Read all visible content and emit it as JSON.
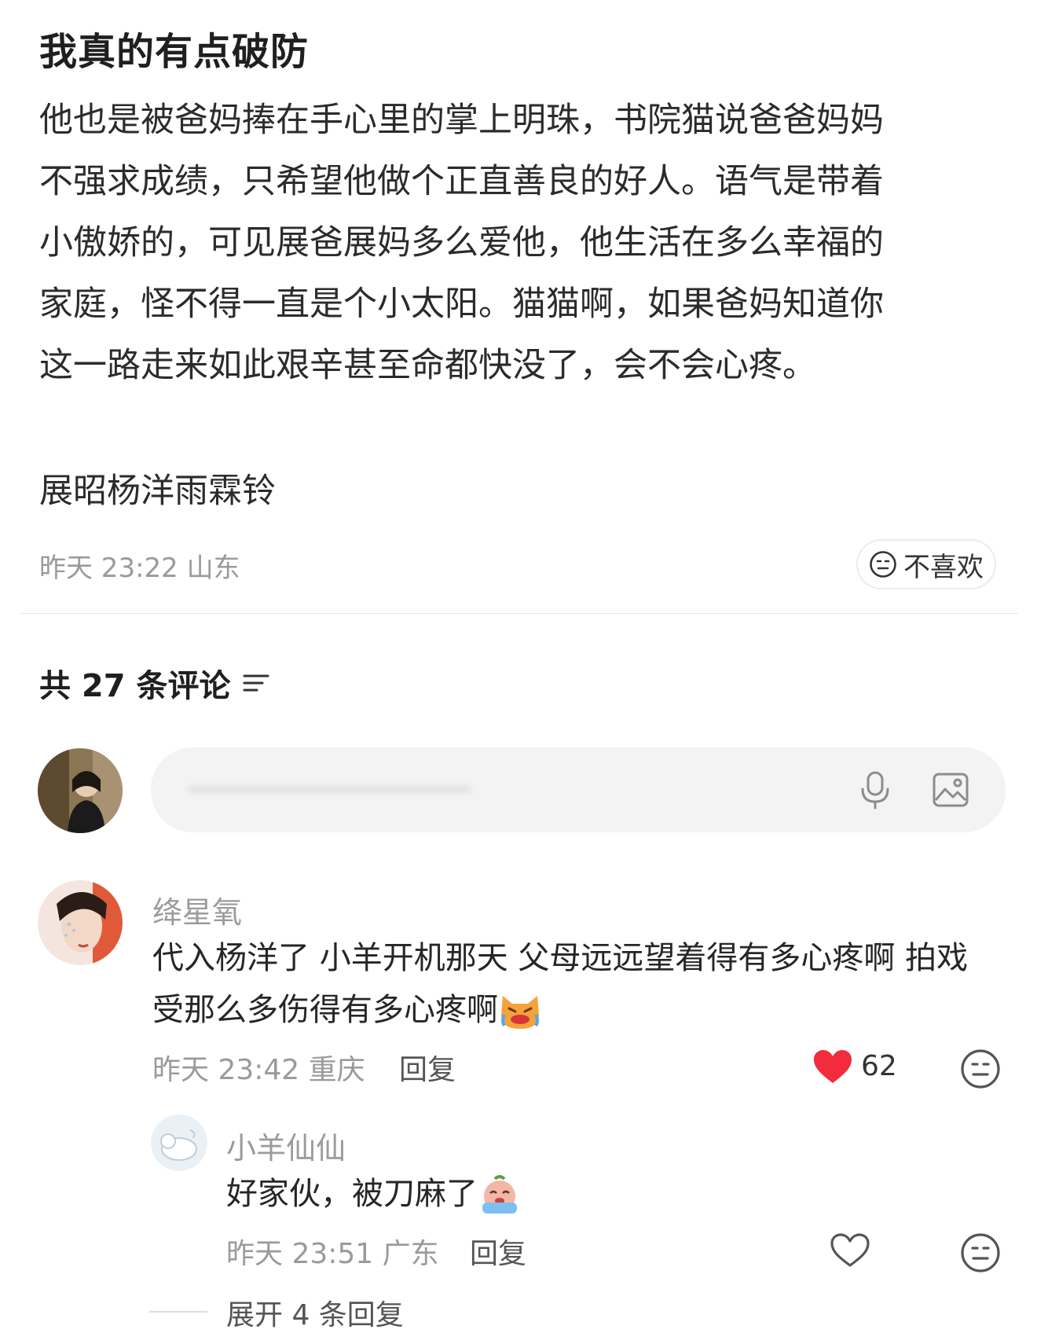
{
  "post": {
    "title": "我真的有点破防",
    "body_lines": [
      "他也是被爸妈捧在手心里的掌上明珠，书院猫说爸爸妈妈",
      "不强求成绩，只希望他做个正直善良的好人。语气是带着",
      "小傲娇的，可见展爸展妈多么爱他，他生活在多么幸福的",
      "家庭，怪不得一直是个小太阳。猫猫啊，如果爸妈知道你",
      "这一路走来如此艰辛甚至命都快没了，会不会心疼。"
    ],
    "topic": "展昭杨洋雨霖铃",
    "meta": "昨天 23:22 山东",
    "dislike_label": "不喜欢"
  },
  "comments_header": {
    "label": "共 27 条评论"
  },
  "composer": {
    "avatar": "user-avatar",
    "placeholder": ""
  },
  "comments": [
    {
      "user": "绛星氧",
      "text_lines": [
        "代入杨洋了 小羊开机那天 父母远远望着得有多心疼啊 拍戏",
        "受那么多伤得有多心疼啊"
      ],
      "meta": "昨天 23:42 重庆",
      "reply_label": "回复",
      "likes": "62",
      "liked": true,
      "like_color": "#f22c3d"
    }
  ],
  "replies": [
    {
      "user": "小羊仙仙",
      "text": "好家伙，被刀麻了",
      "meta": "昨天 23:51 广东",
      "reply_label": "回复",
      "liked": false
    }
  ],
  "expand_label": "展开 4 条回复",
  "icons": {
    "sort": "sort-icon",
    "mic": "microphone-icon",
    "image": "image-icon",
    "heart": "heart-icon",
    "dislike": "neutral-face-icon",
    "cat_emoji": "crying-cat-emoji",
    "cry_emoji": "crying-face-emoji"
  }
}
